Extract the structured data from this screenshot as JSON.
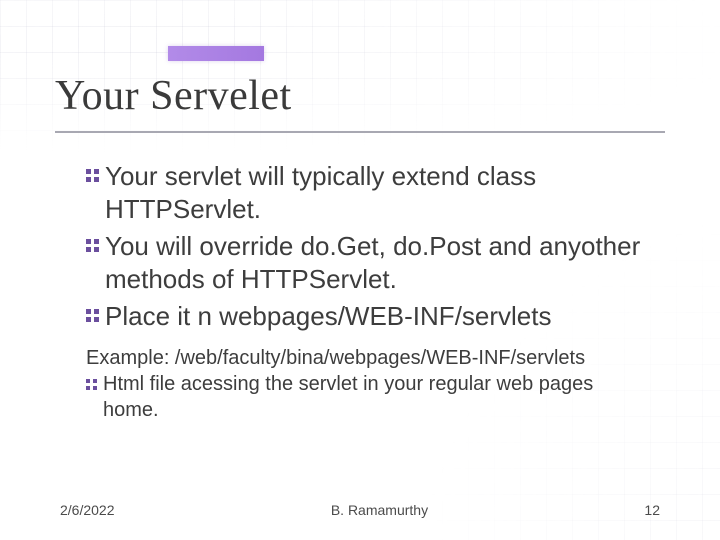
{
  "title": "Your Servelet",
  "bullets": [
    "Your servlet will typically extend class HTTPServlet.",
    "You will override do.Get, do.Post and anyother methods of HTTPServlet.",
    "Place it n webpages/WEB-INF/servlets"
  ],
  "example_line": "Example: /web/faculty/bina/webpages/WEB-INF/servlets",
  "sub_bullet": "Html file acessing the servlet in your regular web pages home.",
  "footer": {
    "date": "2/6/2022",
    "author": "B. Ramamurthy",
    "page": "12"
  }
}
